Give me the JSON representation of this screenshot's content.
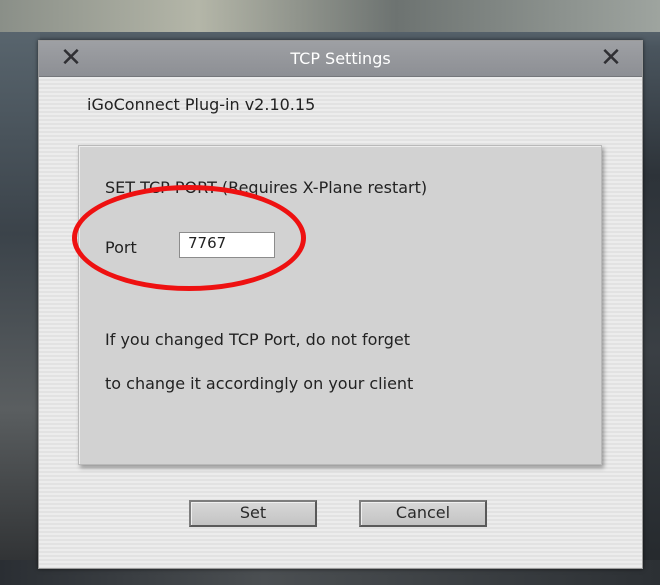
{
  "window": {
    "title": "TCP Settings",
    "close_glyph": "✕"
  },
  "plugin_label": "iGoConnect Plug-in v2.10.15",
  "panel": {
    "heading": "SET TCP PORT (Requires X-Plane restart)",
    "port_label": "Port",
    "port_value": "7767",
    "note_line1": "If you changed TCP Port, do not forget",
    "note_line2": "to change it accordingly on your client"
  },
  "buttons": {
    "set_label": "Set",
    "cancel_label": "Cancel"
  },
  "annotation": {
    "color": "#ee1111",
    "shape": "ellipse-around-port"
  },
  "icons": {
    "close": "close-icon"
  }
}
